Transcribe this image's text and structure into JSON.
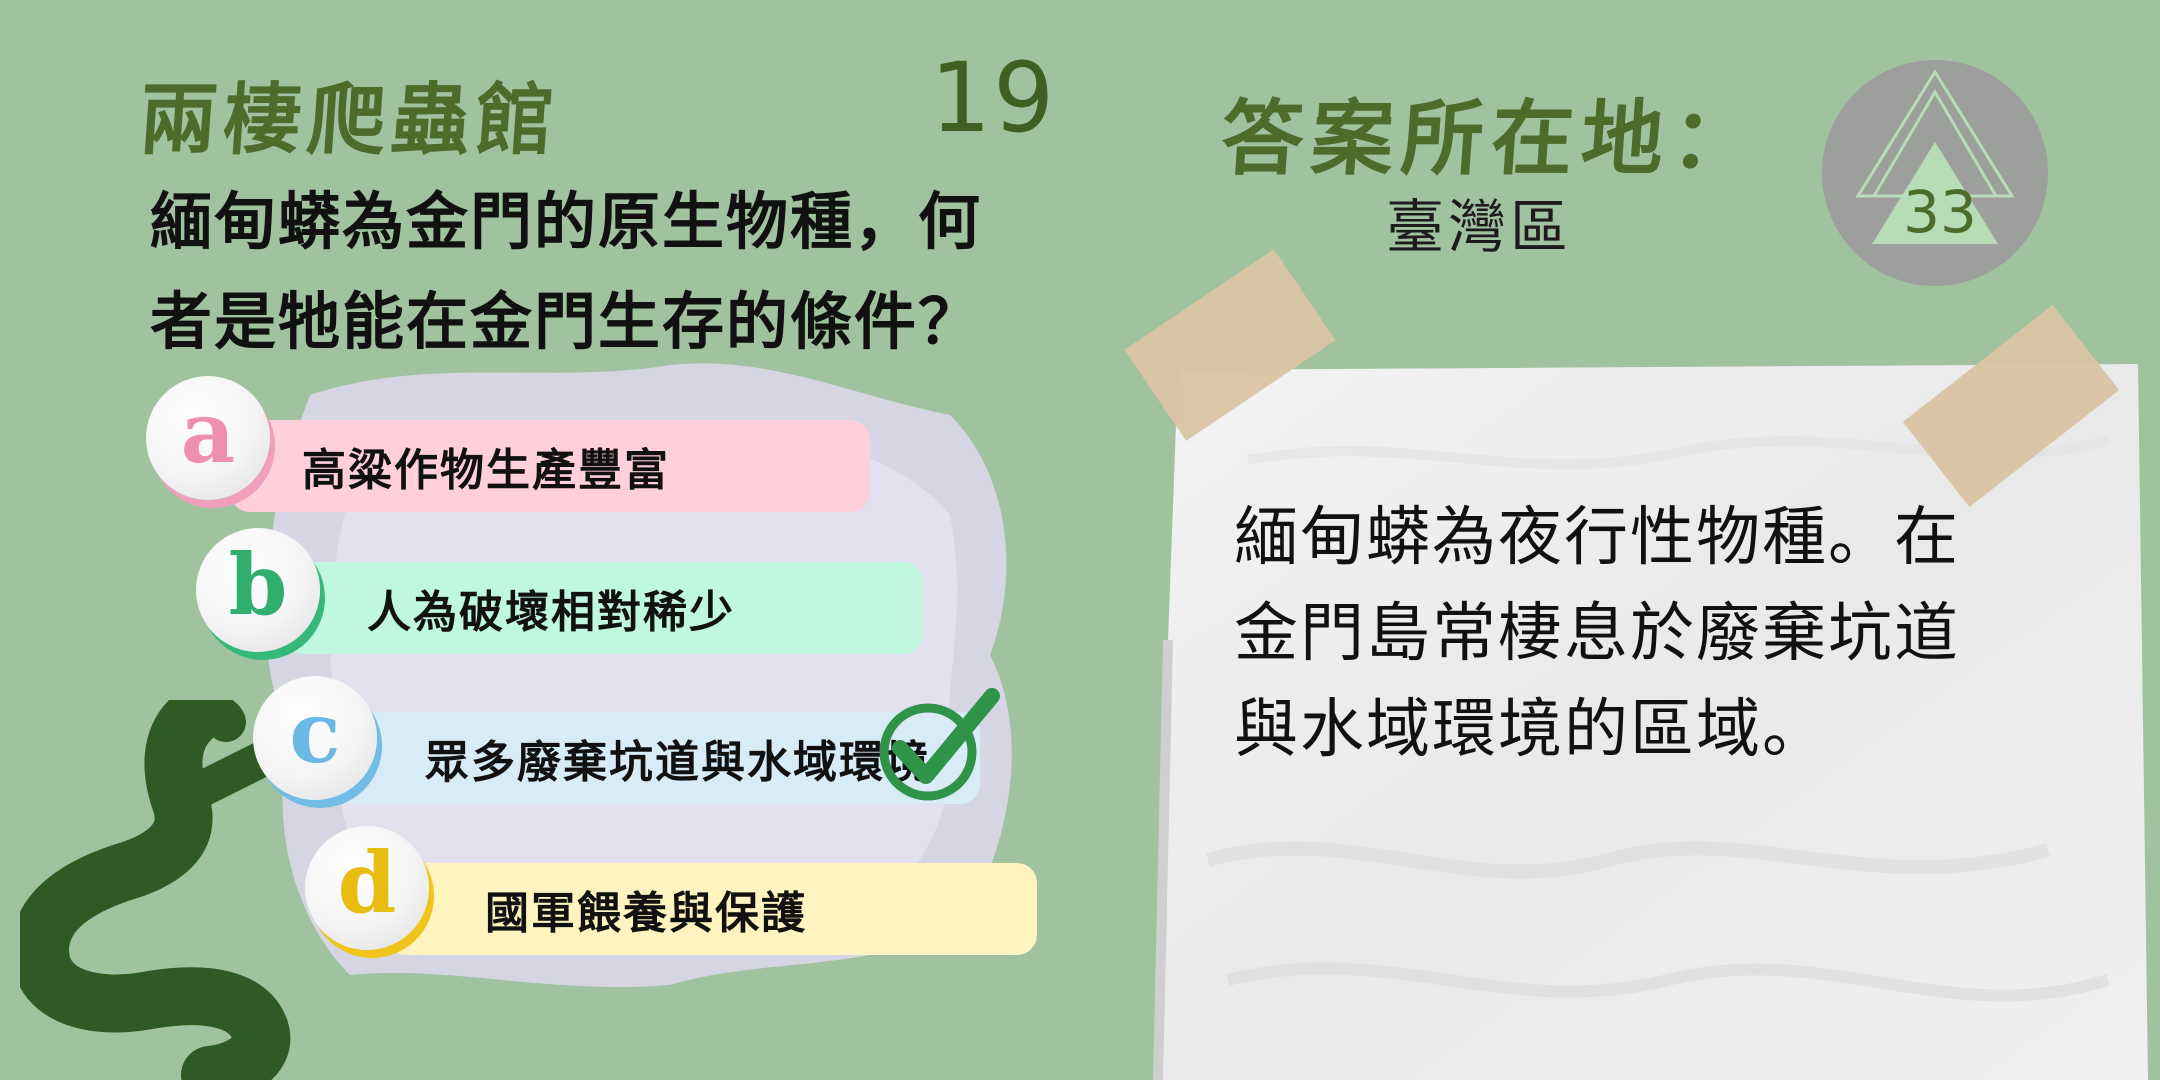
{
  "header": {
    "category": "兩棲爬蟲館",
    "question_number": "19"
  },
  "question": {
    "line1": "緬甸蟒為金門的原生物種，何",
    "line2": "者是牠能在金門生存的條件？"
  },
  "options": [
    {
      "letter": "a",
      "text": "高粱作物生產豐富",
      "color": "#ffcfdb"
    },
    {
      "letter": "b",
      "text": "人為破壞相對稀少",
      "color": "#c0f7df"
    },
    {
      "letter": "c",
      "text": "眾多廢棄坑道與水域環境",
      "color": "#d8ecf8",
      "correct": true
    },
    {
      "letter": "d",
      "text": "國軍餵養與保護",
      "color": "#fff3bf"
    }
  ],
  "answer": {
    "label": "答案所在地：",
    "location": "臺灣區",
    "badge_number": "33"
  },
  "explanation": {
    "line1": "緬甸蟒為夜行性物種。在",
    "line2": "金門島常棲息於廢棄坑道",
    "line3": "與水域環境的區域。"
  },
  "icons": {
    "check": "check-mark-icon",
    "snake": "snake-icon",
    "badge": "triangle-badge-icon"
  },
  "colors": {
    "background": "#a0c29f",
    "title_green": "#4d6b2b",
    "check_green": "#2f9448",
    "snake_green": "#2f5a24"
  }
}
